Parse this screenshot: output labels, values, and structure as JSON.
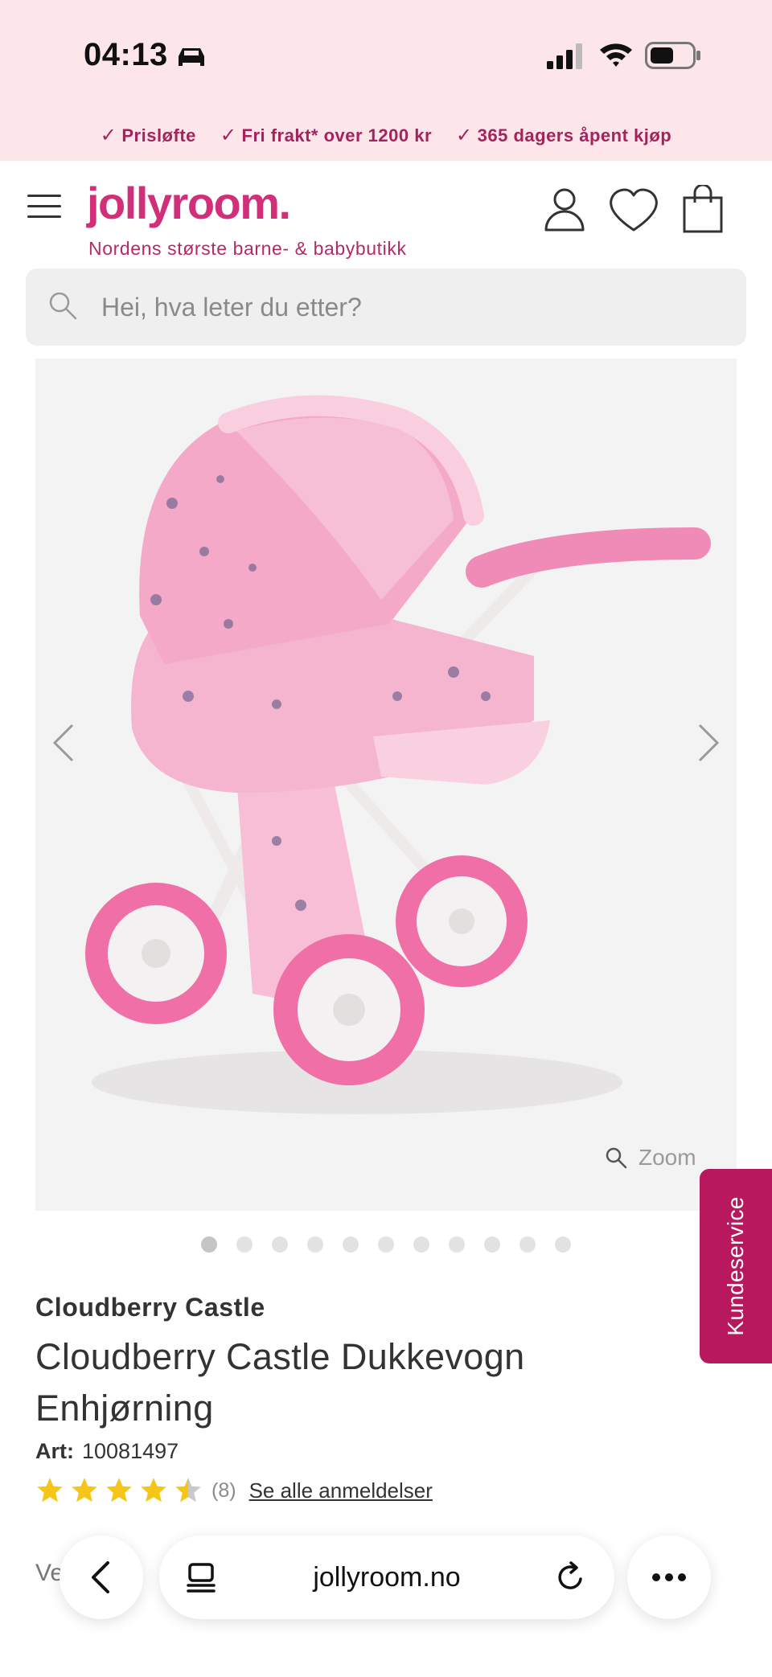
{
  "status_bar": {
    "time": "04:13",
    "icons": [
      "car-icon",
      "signal-icon",
      "wifi-icon",
      "battery-icon"
    ]
  },
  "promo": [
    {
      "label": "Prisløfte"
    },
    {
      "label": "Fri frakt* over 1200 kr"
    },
    {
      "label": "365 dagers åpent kjøp"
    }
  ],
  "header": {
    "brand": "jollyroom.",
    "tagline": "Nordens største barne- & babybutikk",
    "icons": [
      "menu-icon",
      "user-icon",
      "heart-icon",
      "bag-icon"
    ]
  },
  "search": {
    "placeholder": "Hei, hva leter du etter?"
  },
  "gallery": {
    "zoom_label": "Zoom",
    "image_count": 11,
    "active_index": 0
  },
  "side_tab": {
    "label": "Kundeservice"
  },
  "product": {
    "brand": "Cloudberry Castle",
    "title": "Cloudberry Castle Dukkevogn Enhjørning",
    "art_label": "Art:",
    "art_number": "10081497",
    "rating": 4.5,
    "review_count": "(8)",
    "reviews_link": "Se alle anmeldelser",
    "partial_text": "Ve"
  },
  "browser": {
    "url": "jollyroom.no"
  },
  "colors": {
    "brand_pink": "#d22f7a",
    "promo_text": "#a3235d",
    "top_bg": "#fce6ea",
    "kundeservice_bg": "#b8195e",
    "star": "#f5c518"
  }
}
